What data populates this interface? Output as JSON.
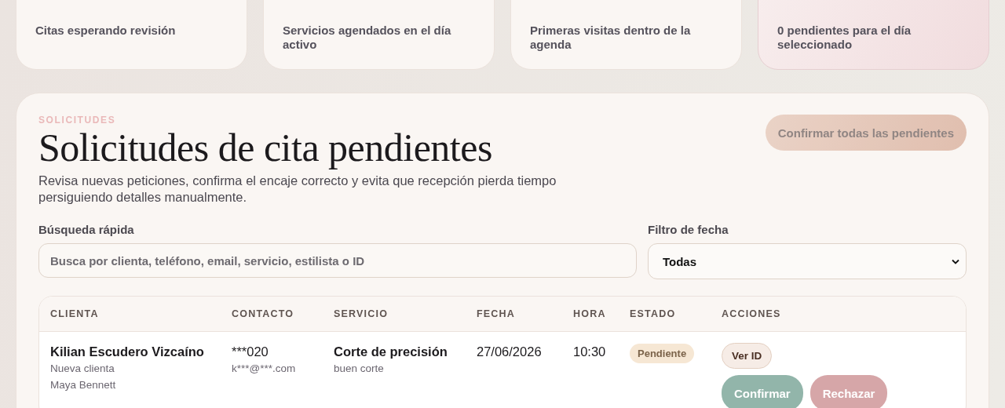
{
  "stats": [
    {
      "label": "Citas esperando revisión",
      "highlighted": false
    },
    {
      "label": "Servicios agendados en el día activo",
      "highlighted": false
    },
    {
      "label": "Primeras visitas dentro de la agenda",
      "highlighted": false
    },
    {
      "label": "0 pendientes para el día seleccionado",
      "highlighted": true
    }
  ],
  "section": {
    "eyebrow": "SOLICITUDES",
    "title": "Solicitudes de cita pendientes",
    "description": "Revisa nuevas peticiones, confirma el encaje correcto y evita que recepción pierda tiempo persiguiendo detalles manualmente.",
    "bulk_button": {
      "label": "Confirmar todas las pendientes",
      "disabled": true
    }
  },
  "search": {
    "label": "Búsqueda rápida",
    "placeholder": "Busca por clienta, teléfono, email, servicio, estilista o ID"
  },
  "date_filter": {
    "label": "Filtro de fecha",
    "value": "Todas"
  },
  "table": {
    "columns": [
      "CLIENTA",
      "CONTACTO",
      "SERVICIO",
      "FECHA",
      "HORA",
      "ESTADO",
      "ACCIONES"
    ],
    "rows": [
      {
        "client": "Kilian Escudero Vizcaíno",
        "client_type": "Nueva clienta",
        "stylist": "Maya Bennett",
        "phone": "***020",
        "email": "k***@***.com",
        "service": "Corte de precisión",
        "service_note": "buen corte",
        "date": "27/06/2026",
        "time": "10:30",
        "status": "Pendiente",
        "actions": [
          {
            "label": "Ver ID",
            "kind": "secondary"
          },
          {
            "label": "Confirmar",
            "kind": "confirm"
          },
          {
            "label": "Rechazar",
            "kind": "reject"
          }
        ]
      }
    ]
  }
}
